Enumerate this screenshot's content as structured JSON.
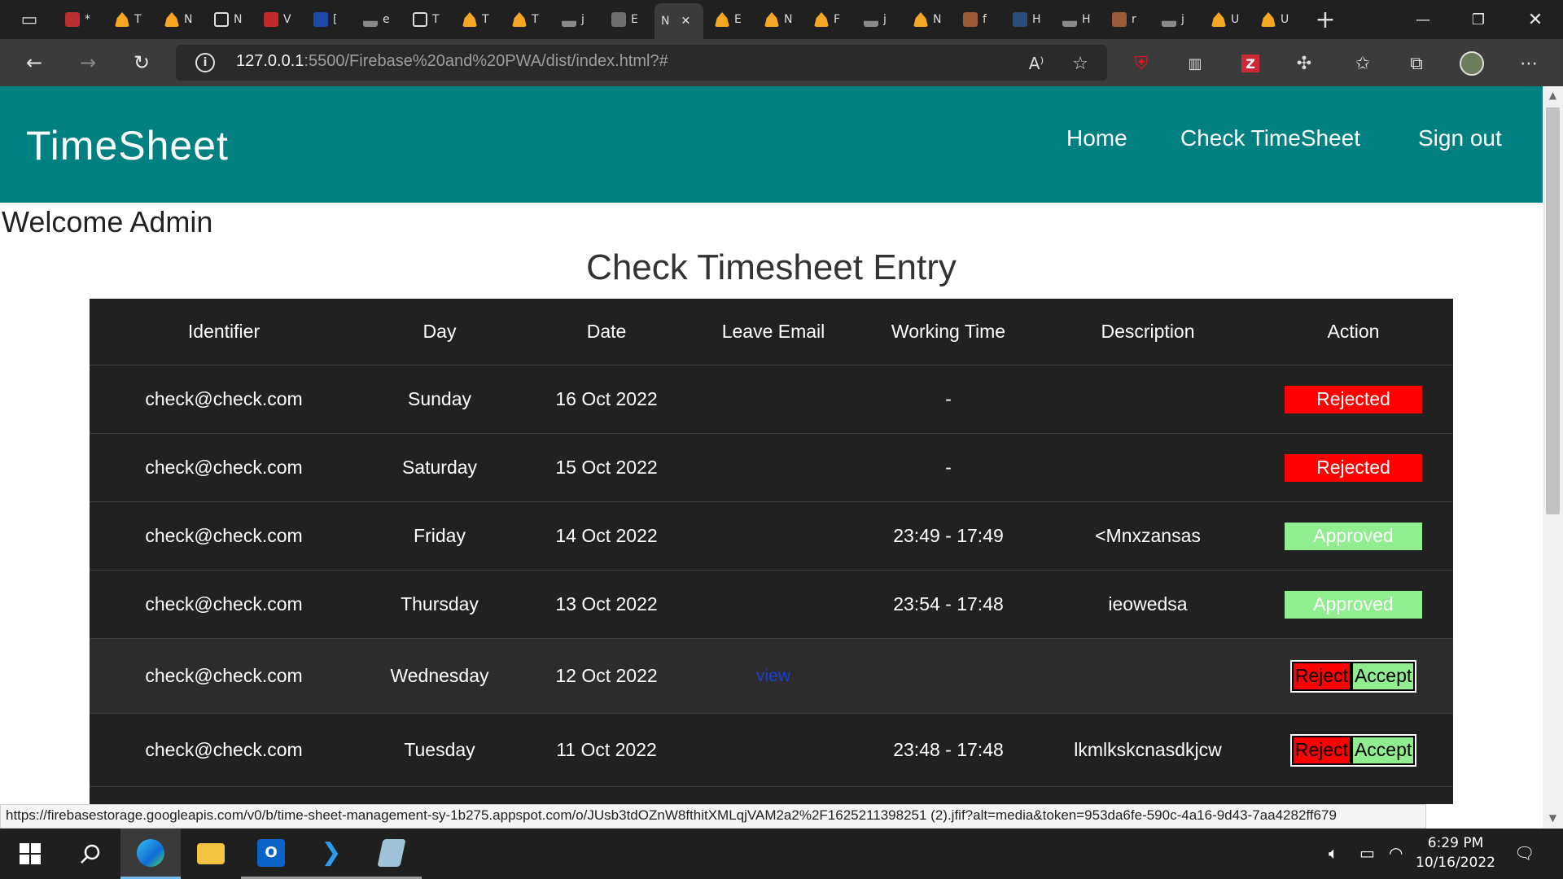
{
  "browser": {
    "tabs": [
      {
        "icon": "pdf-icon",
        "letter": "*"
      },
      {
        "icon": "firebase-icon",
        "letter": "T"
      },
      {
        "icon": "firebase-icon",
        "letter": "N"
      },
      {
        "icon": "document-icon",
        "letter": "N"
      },
      {
        "icon": "red-circle-icon",
        "letter": "V"
      },
      {
        "icon": "blue-circle-icon",
        "letter": "["
      },
      {
        "icon": "stackoverflow-icon",
        "letter": "e"
      },
      {
        "icon": "document-icon",
        "letter": "T"
      },
      {
        "icon": "firebase-icon",
        "letter": "T"
      },
      {
        "icon": "firebase-icon",
        "letter": "T"
      },
      {
        "icon": "stackoverflow-icon",
        "letter": "j"
      },
      {
        "icon": "ex-icon",
        "letter": "E"
      },
      {
        "icon": "active-tab",
        "letter": "N"
      },
      {
        "icon": "firebase-icon",
        "letter": "E"
      },
      {
        "icon": "firebase-icon",
        "letter": "N"
      },
      {
        "icon": "firebase-icon",
        "letter": "F"
      },
      {
        "icon": "stackoverflow-icon",
        "letter": "j"
      },
      {
        "icon": "firebase-icon",
        "letter": "N"
      },
      {
        "icon": "brown-circle-icon",
        "letter": "f"
      },
      {
        "icon": "ub-icon",
        "letter": "H"
      },
      {
        "icon": "stackoverflow-icon",
        "letter": "H"
      },
      {
        "icon": "brown-circle-icon",
        "letter": "r"
      },
      {
        "icon": "stackoverflow-icon",
        "letter": "j"
      },
      {
        "icon": "firebase-icon",
        "letter": "U"
      },
      {
        "icon": "firebase-icon",
        "letter": "U"
      }
    ],
    "url_host": "127.0.0.1",
    "url_rest": ":5500/Firebase%20and%20PWA/dist/index.html?#",
    "link_preview": "https://firebasestorage.googleapis.com/v0/b/time-sheet-management-sy-1b275.appspot.com/o/JUsb3tdOZnW8fthitXMLqjVAM2a2%2F1625211398251 (2).jfif?alt=media&token=953da6fe-590c-4a16-9d43-7aa4282ff679"
  },
  "app": {
    "brand": "TimeSheet",
    "nav": {
      "home": "Home",
      "check": "Check TimeSheet",
      "signout": "Sign out"
    },
    "welcome": "Welcome Admin",
    "title": "Check Timesheet Entry"
  },
  "table": {
    "headers": {
      "identifier": "Identifier",
      "day": "Day",
      "date": "Date",
      "leave": "Leave Email",
      "working": "Working Time",
      "description": "Description",
      "action": "Action"
    },
    "rows": [
      {
        "identifier": "check@check.com",
        "day": "Sunday",
        "date": "16 Oct 2022",
        "leave": "",
        "working": "-",
        "description": "",
        "status": "Rejected"
      },
      {
        "identifier": "check@check.com",
        "day": "Saturday",
        "date": "15 Oct 2022",
        "leave": "",
        "working": "-",
        "description": "",
        "status": "Rejected"
      },
      {
        "identifier": "check@check.com",
        "day": "Friday",
        "date": "14 Oct 2022",
        "leave": "",
        "working": "23:49 - 17:49",
        "description": "<Mnxzansas",
        "status": "Approved"
      },
      {
        "identifier": "check@check.com",
        "day": "Thursday",
        "date": "13 Oct 2022",
        "leave": "",
        "working": "23:54 - 17:48",
        "description": "ieowedsa",
        "status": "Approved"
      },
      {
        "identifier": "check@check.com",
        "day": "Wednesday",
        "date": "12 Oct 2022",
        "leave": "view",
        "working": "",
        "description": "",
        "reject": "Reject",
        "accept": "Accept"
      },
      {
        "identifier": "check@check.com",
        "day": "Tuesday",
        "date": "11 Oct 2022",
        "leave": "",
        "working": "23:48 - 17:48",
        "description": "lkmlkskcnasdkjcw",
        "reject": "Reject",
        "accept": "Accept"
      }
    ]
  },
  "taskbar": {
    "time": "6:29 PM",
    "date": "10/16/2022"
  },
  "colors": {
    "nav_teal": "#008080",
    "table_bg": "#212121",
    "rejected": "#ff0000",
    "approved": "#90ee90",
    "link_blue": "#1a3fd6"
  }
}
